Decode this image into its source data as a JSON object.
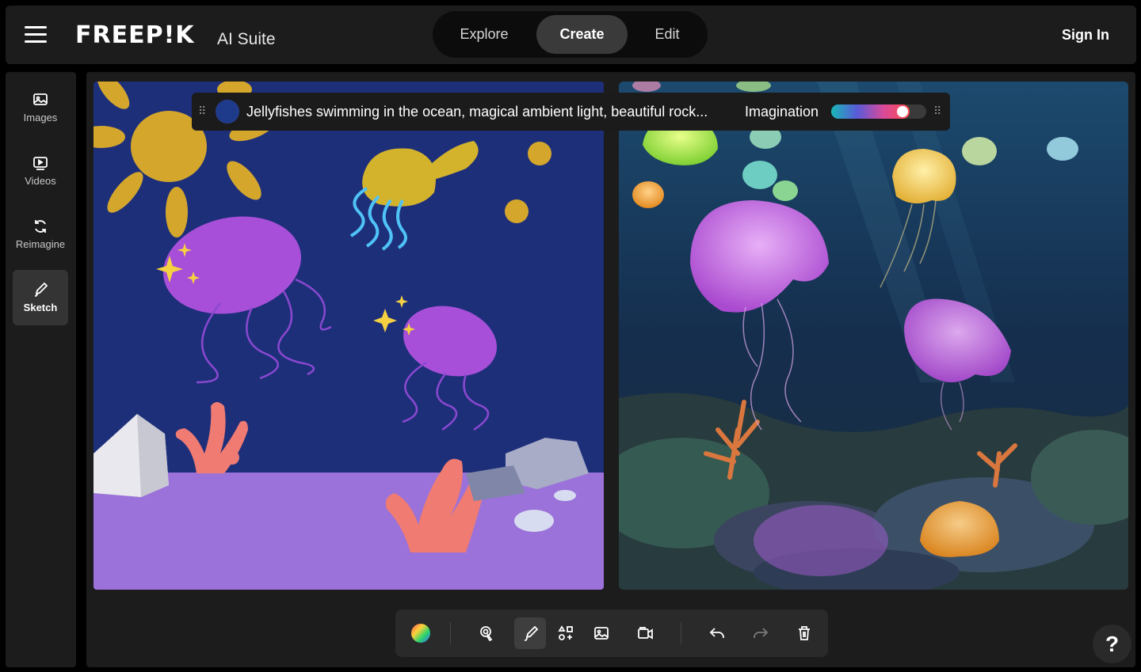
{
  "header": {
    "logo": "FREEP!K",
    "suite": "AI Suite",
    "tabs": [
      {
        "label": "Explore"
      },
      {
        "label": "Create"
      },
      {
        "label": "Edit"
      }
    ],
    "active_tab": "Create",
    "sign_in": "Sign In"
  },
  "sidebar": {
    "items": [
      {
        "label": "Images",
        "icon": "images-icon"
      },
      {
        "label": "Videos",
        "icon": "videos-icon"
      },
      {
        "label": "Reimagine",
        "icon": "reimagine-icon"
      },
      {
        "label": "Sketch",
        "icon": "sketch-icon"
      }
    ],
    "active": "Sketch"
  },
  "prompt": {
    "text": "Jellyfishes swimming in the ocean, magical ambient light, beautiful rock...",
    "color": "#1e3a8a",
    "imagination_label": "Imagination",
    "imagination_level": 0.75
  },
  "toolbar": {
    "tools": [
      "color-picker",
      "pointer",
      "brush",
      "shapes",
      "image",
      "camera",
      "undo",
      "redo",
      "delete"
    ],
    "active": "brush"
  },
  "help": {
    "label": "?"
  },
  "colors": {
    "sketch_background": "#1e2f7a",
    "sketch_floor": "#9b72d9",
    "accent": "#ff4d4d"
  }
}
